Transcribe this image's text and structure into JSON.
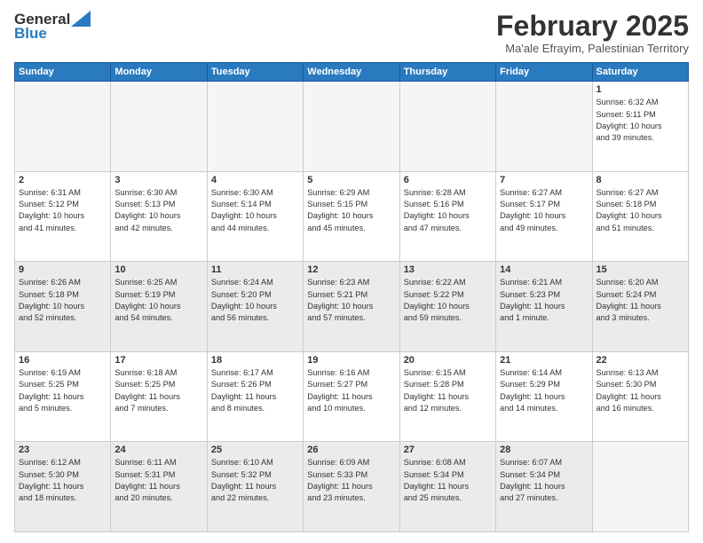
{
  "header": {
    "logo_general": "General",
    "logo_blue": "Blue",
    "month_title": "February 2025",
    "location": "Ma'ale Efrayim, Palestinian Territory"
  },
  "days_of_week": [
    "Sunday",
    "Monday",
    "Tuesday",
    "Wednesday",
    "Thursday",
    "Friday",
    "Saturday"
  ],
  "weeks": [
    [
      {
        "day": "",
        "info": "",
        "empty": true
      },
      {
        "day": "",
        "info": "",
        "empty": true
      },
      {
        "day": "",
        "info": "",
        "empty": true
      },
      {
        "day": "",
        "info": "",
        "empty": true
      },
      {
        "day": "",
        "info": "",
        "empty": true
      },
      {
        "day": "",
        "info": "",
        "empty": true
      },
      {
        "day": "1",
        "info": "Sunrise: 6:32 AM\nSunset: 5:11 PM\nDaylight: 10 hours\nand 39 minutes.",
        "empty": false
      }
    ],
    [
      {
        "day": "2",
        "info": "Sunrise: 6:31 AM\nSunset: 5:12 PM\nDaylight: 10 hours\nand 41 minutes.",
        "empty": false
      },
      {
        "day": "3",
        "info": "Sunrise: 6:30 AM\nSunset: 5:13 PM\nDaylight: 10 hours\nand 42 minutes.",
        "empty": false
      },
      {
        "day": "4",
        "info": "Sunrise: 6:30 AM\nSunset: 5:14 PM\nDaylight: 10 hours\nand 44 minutes.",
        "empty": false
      },
      {
        "day": "5",
        "info": "Sunrise: 6:29 AM\nSunset: 5:15 PM\nDaylight: 10 hours\nand 45 minutes.",
        "empty": false
      },
      {
        "day": "6",
        "info": "Sunrise: 6:28 AM\nSunset: 5:16 PM\nDaylight: 10 hours\nand 47 minutes.",
        "empty": false
      },
      {
        "day": "7",
        "info": "Sunrise: 6:27 AM\nSunset: 5:17 PM\nDaylight: 10 hours\nand 49 minutes.",
        "empty": false
      },
      {
        "day": "8",
        "info": "Sunrise: 6:27 AM\nSunset: 5:18 PM\nDaylight: 10 hours\nand 51 minutes.",
        "empty": false
      }
    ],
    [
      {
        "day": "9",
        "info": "Sunrise: 6:26 AM\nSunset: 5:18 PM\nDaylight: 10 hours\nand 52 minutes.",
        "empty": false
      },
      {
        "day": "10",
        "info": "Sunrise: 6:25 AM\nSunset: 5:19 PM\nDaylight: 10 hours\nand 54 minutes.",
        "empty": false
      },
      {
        "day": "11",
        "info": "Sunrise: 6:24 AM\nSunset: 5:20 PM\nDaylight: 10 hours\nand 56 minutes.",
        "empty": false
      },
      {
        "day": "12",
        "info": "Sunrise: 6:23 AM\nSunset: 5:21 PM\nDaylight: 10 hours\nand 57 minutes.",
        "empty": false
      },
      {
        "day": "13",
        "info": "Sunrise: 6:22 AM\nSunset: 5:22 PM\nDaylight: 10 hours\nand 59 minutes.",
        "empty": false
      },
      {
        "day": "14",
        "info": "Sunrise: 6:21 AM\nSunset: 5:23 PM\nDaylight: 11 hours\nand 1 minute.",
        "empty": false
      },
      {
        "day": "15",
        "info": "Sunrise: 6:20 AM\nSunset: 5:24 PM\nDaylight: 11 hours\nand 3 minutes.",
        "empty": false
      }
    ],
    [
      {
        "day": "16",
        "info": "Sunrise: 6:19 AM\nSunset: 5:25 PM\nDaylight: 11 hours\nand 5 minutes.",
        "empty": false
      },
      {
        "day": "17",
        "info": "Sunrise: 6:18 AM\nSunset: 5:25 PM\nDaylight: 11 hours\nand 7 minutes.",
        "empty": false
      },
      {
        "day": "18",
        "info": "Sunrise: 6:17 AM\nSunset: 5:26 PM\nDaylight: 11 hours\nand 8 minutes.",
        "empty": false
      },
      {
        "day": "19",
        "info": "Sunrise: 6:16 AM\nSunset: 5:27 PM\nDaylight: 11 hours\nand 10 minutes.",
        "empty": false
      },
      {
        "day": "20",
        "info": "Sunrise: 6:15 AM\nSunset: 5:28 PM\nDaylight: 11 hours\nand 12 minutes.",
        "empty": false
      },
      {
        "day": "21",
        "info": "Sunrise: 6:14 AM\nSunset: 5:29 PM\nDaylight: 11 hours\nand 14 minutes.",
        "empty": false
      },
      {
        "day": "22",
        "info": "Sunrise: 6:13 AM\nSunset: 5:30 PM\nDaylight: 11 hours\nand 16 minutes.",
        "empty": false
      }
    ],
    [
      {
        "day": "23",
        "info": "Sunrise: 6:12 AM\nSunset: 5:30 PM\nDaylight: 11 hours\nand 18 minutes.",
        "empty": false
      },
      {
        "day": "24",
        "info": "Sunrise: 6:11 AM\nSunset: 5:31 PM\nDaylight: 11 hours\nand 20 minutes.",
        "empty": false
      },
      {
        "day": "25",
        "info": "Sunrise: 6:10 AM\nSunset: 5:32 PM\nDaylight: 11 hours\nand 22 minutes.",
        "empty": false
      },
      {
        "day": "26",
        "info": "Sunrise: 6:09 AM\nSunset: 5:33 PM\nDaylight: 11 hours\nand 23 minutes.",
        "empty": false
      },
      {
        "day": "27",
        "info": "Sunrise: 6:08 AM\nSunset: 5:34 PM\nDaylight: 11 hours\nand 25 minutes.",
        "empty": false
      },
      {
        "day": "28",
        "info": "Sunrise: 6:07 AM\nSunset: 5:34 PM\nDaylight: 11 hours\nand 27 minutes.",
        "empty": false
      },
      {
        "day": "",
        "info": "",
        "empty": true
      }
    ]
  ]
}
